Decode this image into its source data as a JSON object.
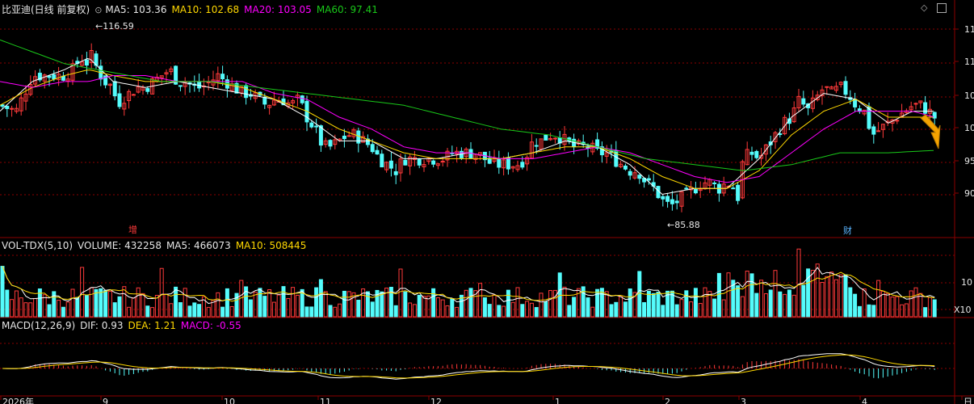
{
  "colors": {
    "bg": "#000000",
    "grid": "#8b0000",
    "up": "#ff3a3a",
    "down": "#54fcfc",
    "white": "#ffffff",
    "ma10": "#ffd800",
    "ma20": "#ff00ff",
    "ma60": "#19c819",
    "dea": "#ffd800"
  },
  "header": {
    "title": "比亚迪(日线 前复权)",
    "ma5": "MA5: 103.36",
    "ma10": "MA10: 102.68",
    "ma20": "MA20: 103.05",
    "ma60": "MA60: 97.41"
  },
  "vol_header": {
    "name": "VOL-TDX(5,10)",
    "volume": "VOLUME: 432258",
    "ma5": "MA5: 466073",
    "ma10": "MA10: 508445"
  },
  "macd_header": {
    "name": "MACD(12,26,9)",
    "dif": "DIF: 0.93",
    "dea": "DEA: 1.21",
    "macd": "MACD: -0.55"
  },
  "annotations": {
    "high": "116.59",
    "low": "85.88",
    "marker_zeng": "增",
    "marker_cai": "财"
  },
  "y_axis_price": [
    "11",
    "11",
    "10",
    "10",
    "95",
    "90"
  ],
  "y_axis_vol": [
    "10",
    "X10"
  ],
  "x_axis": [
    "2026年",
    "9",
    "10",
    "11",
    "12",
    "1",
    "2",
    "3",
    "4",
    "日"
  ],
  "chart_data": [
    {
      "type": "candlestick",
      "title": "比亚迪(日线 前复权)",
      "ylim": [
        83,
        120
      ],
      "high_label": 116.59,
      "low_label": 85.88,
      "close_path": [
        [
          0,
          105
        ],
        [
          20,
          104
        ],
        [
          30,
          107
        ],
        [
          40,
          110
        ],
        [
          50,
          110
        ],
        [
          60,
          110
        ],
        [
          70,
          110
        ],
        [
          80,
          110
        ],
        [
          90,
          111
        ],
        [
          100,
          113
        ],
        [
          110,
          112
        ],
        [
          115,
          114
        ],
        [
          120,
          111
        ],
        [
          130,
          109
        ],
        [
          140,
          108
        ],
        [
          145,
          105
        ],
        [
          150,
          106
        ],
        [
          160,
          107
        ],
        [
          170,
          108
        ],
        [
          180,
          108
        ],
        [
          190,
          109
        ],
        [
          200,
          110
        ],
        [
          210,
          111
        ],
        [
          220,
          109
        ],
        [
          230,
          109
        ],
        [
          240,
          108
        ],
        [
          250,
          108
        ],
        [
          260,
          109
        ],
        [
          270,
          110
        ],
        [
          280,
          109
        ],
        [
          290,
          108
        ],
        [
          300,
          107
        ],
        [
          310,
          107
        ],
        [
          320,
          106
        ],
        [
          330,
          105
        ],
        [
          340,
          106
        ],
        [
          350,
          106
        ],
        [
          360,
          105
        ],
        [
          370,
          106
        ],
        [
          380,
          103
        ],
        [
          390,
          101
        ],
        [
          400,
          98
        ],
        [
          410,
          98
        ],
        [
          420,
          99
        ],
        [
          430,
          100
        ],
        [
          440,
          100
        ],
        [
          450,
          99
        ],
        [
          460,
          98
        ],
        [
          470,
          96
        ],
        [
          480,
          95
        ],
        [
          490,
          94
        ],
        [
          500,
          96
        ],
        [
          510,
          96
        ],
        [
          520,
          96
        ],
        [
          530,
          96
        ],
        [
          540,
          96
        ],
        [
          550,
          96
        ],
        [
          560,
          97
        ],
        [
          570,
          97
        ],
        [
          580,
          97
        ],
        [
          590,
          97
        ],
        [
          600,
          96
        ],
        [
          610,
          95
        ],
        [
          620,
          95
        ],
        [
          630,
          95
        ],
        [
          640,
          95
        ],
        [
          650,
          96
        ],
        [
          660,
          99
        ],
        [
          670,
          99
        ],
        [
          680,
          100
        ],
        [
          690,
          100
        ],
        [
          700,
          99
        ],
        [
          710,
          98
        ],
        [
          720,
          98
        ],
        [
          730,
          98
        ],
        [
          740,
          97
        ],
        [
          750,
          97
        ],
        [
          760,
          96
        ],
        [
          770,
          95
        ],
        [
          780,
          94
        ],
        [
          790,
          94
        ],
        [
          800,
          92
        ],
        [
          810,
          91
        ],
        [
          820,
          89
        ],
        [
          830,
          88
        ],
        [
          840,
          89
        ],
        [
          850,
          90
        ],
        [
          860,
          91
        ],
        [
          870,
          92
        ],
        [
          880,
          92
        ],
        [
          890,
          91
        ],
        [
          900,
          92
        ],
        [
          910,
          91
        ],
        [
          915,
          89
        ],
        [
          920,
          96
        ],
        [
          930,
          97
        ],
        [
          940,
          96
        ],
        [
          950,
          98
        ],
        [
          960,
          100
        ],
        [
          970,
          102
        ],
        [
          980,
          103
        ],
        [
          990,
          106
        ],
        [
          1000,
          104
        ],
        [
          1010,
          106
        ],
        [
          1020,
          108
        ],
        [
          1030,
          107
        ],
        [
          1040,
          108
        ],
        [
          1050,
          107
        ],
        [
          1060,
          105
        ],
        [
          1070,
          104
        ],
        [
          1080,
          100
        ],
        [
          1090,
          101
        ],
        [
          1100,
          102
        ],
        [
          1110,
          103
        ],
        [
          1120,
          104
        ],
        [
          1130,
          105
        ],
        [
          1140,
          105
        ],
        [
          1150,
          104
        ],
        [
          1157,
          103
        ]
      ],
      "ma_series": [
        {
          "name": "MA5",
          "values": [
            [
              0,
              104
            ],
            [
              40,
              109
            ],
            [
              80,
              111
            ],
            [
              110,
              113
            ],
            [
              140,
              109
            ],
            [
              180,
              108
            ],
            [
              220,
              109
            ],
            [
              260,
              108
            ],
            [
              300,
              107
            ],
            [
              340,
              106
            ],
            [
              380,
              103
            ],
            [
              420,
              99
            ],
            [
              460,
              99
            ],
            [
              500,
              96
            ],
            [
              540,
              96
            ],
            [
              580,
              97
            ],
            [
              620,
              96
            ],
            [
              660,
              97
            ],
            [
              700,
              99
            ],
            [
              740,
              98
            ],
            [
              780,
              95
            ],
            [
              820,
              90
            ],
            [
              860,
              91
            ],
            [
              900,
              91
            ],
            [
              940,
              96
            ],
            [
              980,
              103
            ],
            [
              1020,
              107
            ],
            [
              1060,
              106
            ],
            [
              1100,
              102
            ],
            [
              1130,
              104
            ],
            [
              1157,
              104
            ]
          ]
        },
        {
          "name": "MA10",
          "values": [
            [
              0,
              105
            ],
            [
              40,
              108
            ],
            [
              80,
              110
            ],
            [
              110,
              111
            ],
            [
              140,
              110
            ],
            [
              180,
              109
            ],
            [
              220,
              109
            ],
            [
              260,
              109
            ],
            [
              300,
              108
            ],
            [
              340,
              106
            ],
            [
              380,
              104
            ],
            [
              420,
              101
            ],
            [
              460,
              99
            ],
            [
              500,
              97
            ],
            [
              540,
              96
            ],
            [
              580,
              96
            ],
            [
              620,
              96
            ],
            [
              660,
              97
            ],
            [
              700,
              98
            ],
            [
              740,
              98
            ],
            [
              780,
              96
            ],
            [
              820,
              93
            ],
            [
              860,
              91
            ],
            [
              900,
              91
            ],
            [
              940,
              94
            ],
            [
              980,
              100
            ],
            [
              1020,
              104
            ],
            [
              1060,
              106
            ],
            [
              1100,
              103
            ],
            [
              1130,
              103
            ],
            [
              1157,
              103
            ]
          ]
        },
        {
          "name": "MA20",
          "values": [
            [
              0,
              109
            ],
            [
              40,
              108
            ],
            [
              80,
              109
            ],
            [
              110,
              109
            ],
            [
              140,
              110
            ],
            [
              180,
              110
            ],
            [
              220,
              109
            ],
            [
              260,
              109
            ],
            [
              300,
              109
            ],
            [
              340,
              107
            ],
            [
              380,
              106
            ],
            [
              420,
              103
            ],
            [
              460,
              101
            ],
            [
              500,
              98
            ],
            [
              540,
              97
            ],
            [
              580,
              97
            ],
            [
              620,
              96
            ],
            [
              660,
              96
            ],
            [
              700,
              97
            ],
            [
              740,
              98
            ],
            [
              780,
              97
            ],
            [
              820,
              95
            ],
            [
              860,
              93
            ],
            [
              900,
              92
            ],
            [
              940,
              93
            ],
            [
              980,
              97
            ],
            [
              1020,
              101
            ],
            [
              1060,
              104
            ],
            [
              1100,
              104
            ],
            [
              1130,
              104
            ],
            [
              1157,
              103
            ]
          ]
        },
        {
          "name": "MA60",
          "values": [
            [
              0,
              116
            ],
            [
              40,
              114
            ],
            [
              80,
              112
            ],
            [
              120,
              111
            ],
            [
              160,
              110
            ],
            [
              200,
              109
            ],
            [
              260,
              109
            ],
            [
              320,
              108
            ],
            [
              380,
              107
            ],
            [
              440,
              106
            ],
            [
              500,
              105
            ],
            [
              560,
              103
            ],
            [
              620,
              101
            ],
            [
              680,
              100
            ],
            [
              740,
              98
            ],
            [
              800,
              96
            ],
            [
              860,
              95
            ],
            [
              920,
              94
            ],
            [
              980,
              95
            ],
            [
              1040,
              97
            ],
            [
              1100,
              97
            ],
            [
              1157,
              97.4
            ]
          ]
        }
      ]
    },
    {
      "type": "bar",
      "title": "VOL-TDX(5,10)",
      "series": [
        {
          "name": "VOLUME"
        },
        {
          "name": "MA5"
        },
        {
          "name": "MA10"
        }
      ]
    },
    {
      "type": "bar",
      "title": "MACD(12,26,9)",
      "series": [
        {
          "name": "DIF"
        },
        {
          "name": "DEA"
        },
        {
          "name": "MACD"
        }
      ]
    }
  ]
}
